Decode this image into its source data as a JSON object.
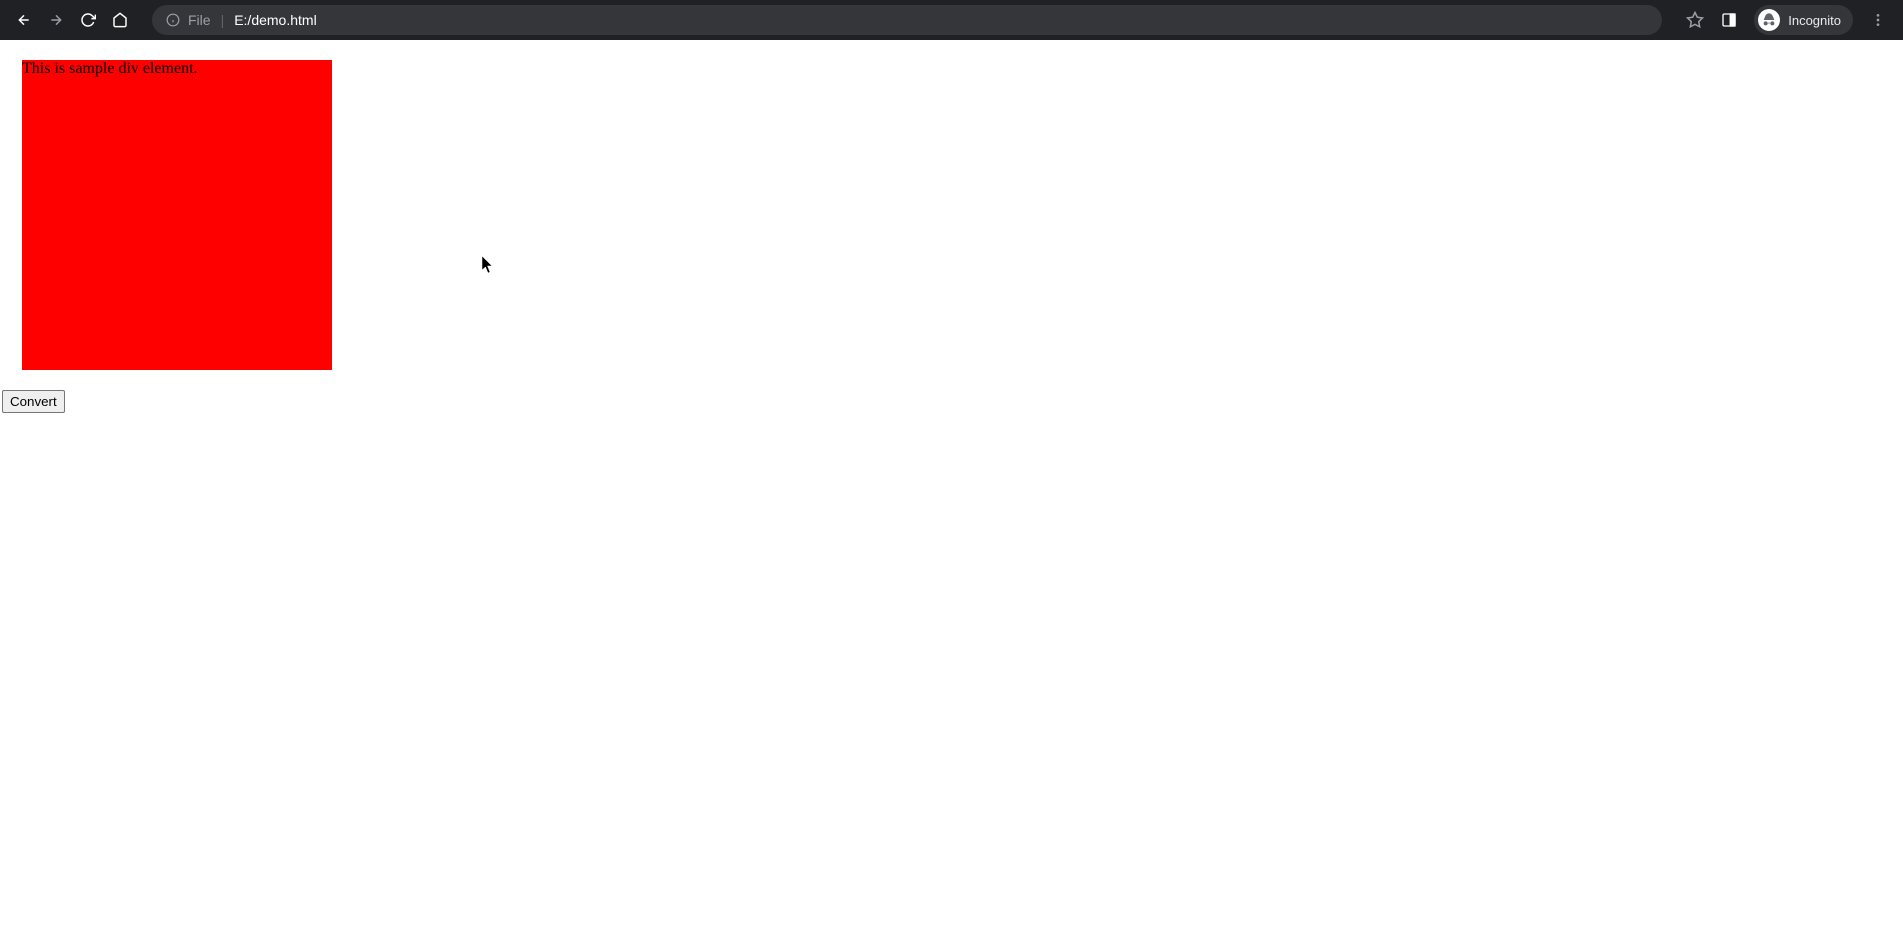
{
  "browser": {
    "url_prefix": "File",
    "url_divider": "|",
    "url_path": "E:/demo.html",
    "incognito_label": "Incognito"
  },
  "page": {
    "sample_text": "This is sample div element.",
    "button_label": "Convert"
  }
}
